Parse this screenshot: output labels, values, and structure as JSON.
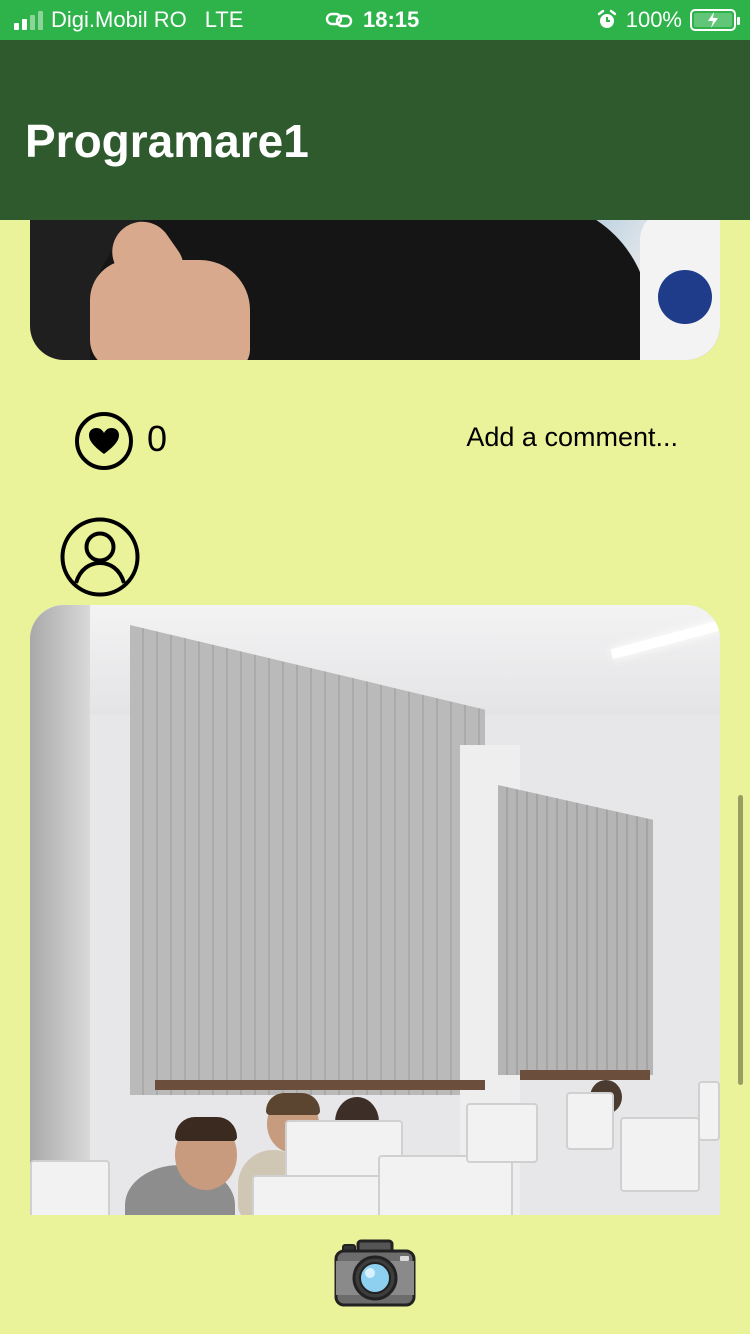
{
  "status_bar": {
    "carrier": "Digi.Mobil RO",
    "network": "LTE",
    "time": "18:15",
    "battery": "100%"
  },
  "app_bar": {
    "title": "Programare1"
  },
  "post": {
    "likes": "0",
    "comment_placeholder": "Add a comment..."
  },
  "icons": {
    "like": "heart-icon",
    "avatar": "user-icon",
    "camera": "camera-icon"
  },
  "colors": {
    "status_bar": "#2db34a",
    "app_bar": "#2f5a2e",
    "background": "#eaf29a"
  }
}
